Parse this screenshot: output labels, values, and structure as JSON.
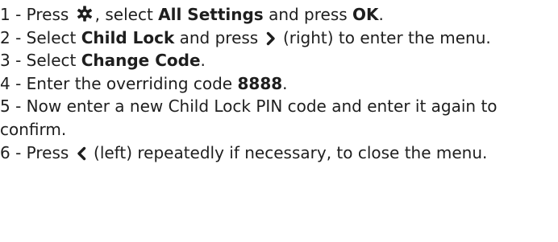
{
  "steps": [
    {
      "num": "1 - ",
      "p1": "Press ",
      "icon": "gear-icon",
      "p2": ", select ",
      "b1": "All Settings",
      "p3": " and press ",
      "b2": "OK",
      "p4": "."
    },
    {
      "num": "2 - ",
      "p1": "Select ",
      "b1": "Child Lock",
      "p2": " and press ",
      "icon": "chevron-right-icon",
      "p3": " (right) to enter the menu."
    },
    {
      "num": "3 - ",
      "p1": "Select ",
      "b1": "Change Code",
      "p2": "."
    },
    {
      "num": "4 - ",
      "p1": "Enter the overriding code ",
      "b1": "8888",
      "p2": "."
    },
    {
      "num": "5 - ",
      "p1": "Now enter a new Child Lock PIN code and enter it again to confirm."
    },
    {
      "num": "6 - ",
      "p1": "Press ",
      "icon": "chevron-left-icon",
      "p2": " (left) repeatedly if necessary, to close the menu."
    }
  ]
}
